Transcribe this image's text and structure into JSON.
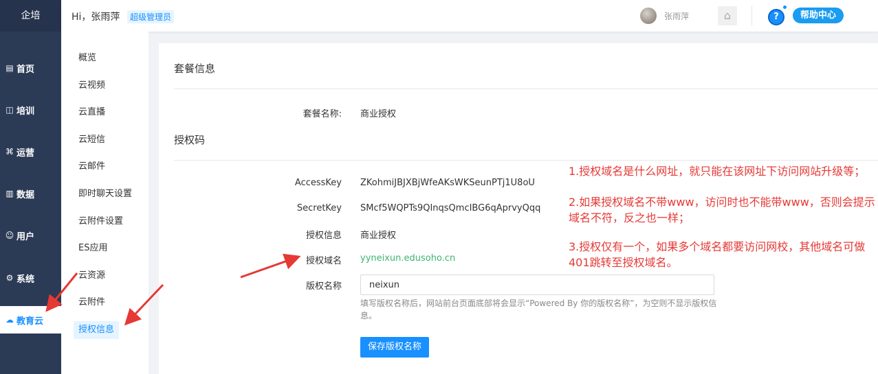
{
  "sidebar": {
    "brand": "企培",
    "items": [
      {
        "label": "首页",
        "icon": "dashboard-icon",
        "glyph": "▤"
      },
      {
        "label": "培训",
        "icon": "training-icon",
        "glyph": "◫"
      },
      {
        "label": "运营",
        "icon": "operations-icon",
        "glyph": "⌘"
      },
      {
        "label": "数据",
        "icon": "data-chart-icon",
        "glyph": "▥"
      },
      {
        "label": "用户",
        "icon": "user-icon",
        "glyph": "☺"
      },
      {
        "label": "系统",
        "icon": "settings-icon",
        "glyph": "⚙"
      },
      {
        "label": "教育云",
        "icon": "cloud-icon",
        "glyph": "☁",
        "active": true
      }
    ]
  },
  "header": {
    "greeting": "Hi，张雨萍",
    "role_badge": "超级管理员",
    "username": "张雨萍",
    "help_label": "帮助中心",
    "help_glyph": "?"
  },
  "subnav": {
    "items": [
      "概览",
      "云视频",
      "云直播",
      "云短信",
      "云邮件",
      "即时聊天设置",
      "云附件设置",
      "ES应用",
      "云资源",
      "云附件",
      "授权信息"
    ],
    "active": "授权信息"
  },
  "main": {
    "package_section_title": "套餐信息",
    "package_name_label": "套餐名称:",
    "package_name_value": "商业授权",
    "auth_section_title": "授权码",
    "fields": {
      "access_key_label": "AccessKey",
      "access_key_value": "ZKohmiJBJXBjWfeAKsWKSeunPTj1U8oU",
      "secret_key_label": "SecretKey",
      "secret_key_value": "SMcf5WQPTs9QInqsQmcIBG6qAprvyQqq",
      "auth_info_label": "授权信息",
      "auth_info_value": "商业授权",
      "auth_domain_label": "授权域名",
      "auth_domain_value": "yyneixun.edusoho.cn",
      "copyright_label": "版权名称",
      "copyright_value": "neixun",
      "copyright_hint": "填写版权名称后，网站前台页面底部将会显示“Powered By 你的版权名称”，为空则不显示版权信息。",
      "save_button": "保存版权名称"
    }
  },
  "annotations": {
    "note1": "1.授权域名是什么网址，就只能在该网址下访问网站升级等；",
    "note2": "2.如果授权域名不带www，访问时也不能带www，否则会提示域名不符，反之也一样；",
    "note3": "3.授权仅有一个，如果多个域名都要访问网校，其他域名可做401跳转至授权域名。",
    "color": "#e53935"
  },
  "colors": {
    "sidebar_bg": "#2b3a55",
    "accent": "#1890ff",
    "domain_link": "#3cb371"
  }
}
